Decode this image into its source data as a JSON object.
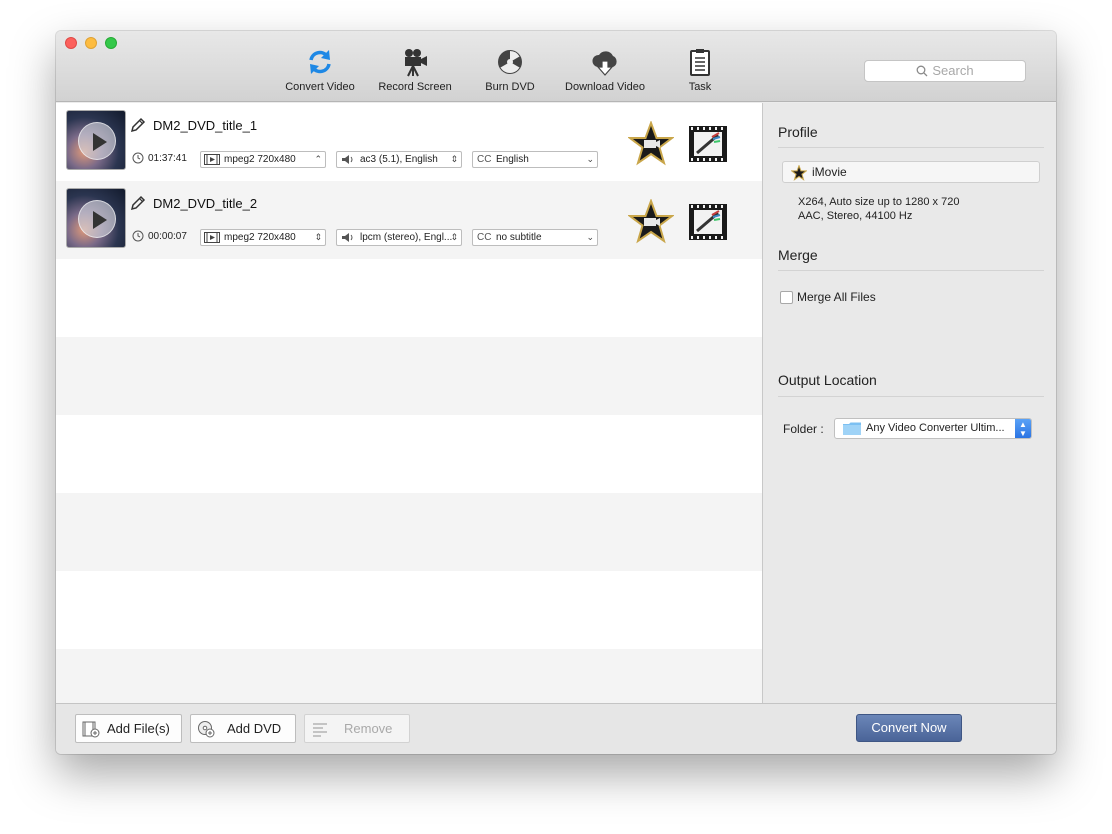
{
  "toolbar": {
    "items": [
      {
        "label": "Convert Video",
        "icon": "convert-video-icon"
      },
      {
        "label": "Record Screen",
        "icon": "record-screen-icon"
      },
      {
        "label": "Burn DVD",
        "icon": "burn-dvd-icon"
      },
      {
        "label": "Download Video",
        "icon": "download-video-icon"
      },
      {
        "label": "Task",
        "icon": "task-icon"
      }
    ],
    "search_placeholder": "Search"
  },
  "files": [
    {
      "title": "DM2_DVD_title_1",
      "duration": "01:37:41",
      "video": "mpeg2 720x480",
      "audio": "ac3 (5.1), English",
      "subtitle_tag": "CC",
      "subtitle": "English"
    },
    {
      "title": "DM2_DVD_title_2",
      "duration": "00:00:07",
      "video": "mpeg2 720x480",
      "audio": "lpcm (stereo), Engl...",
      "subtitle_tag": "CC",
      "subtitle": "no subtitle"
    }
  ],
  "panel": {
    "profile_heading": "Profile",
    "profile_name": "iMovie",
    "profile_desc_1": "X264, Auto size up to 1280 x 720",
    "profile_desc_2": "AAC, Stereo, 44100 Hz",
    "merge_heading": "Merge",
    "merge_label": "Merge All Files",
    "merge_checked": false,
    "output_heading": "Output Location",
    "folder_label": "Folder :",
    "folder_value": "Any Video Converter Ultim..."
  },
  "bottom": {
    "add_files": "Add File(s)",
    "add_dvd": "Add DVD",
    "remove": "Remove",
    "convert": "Convert Now"
  },
  "colors": {
    "convert_button": "#4a6498",
    "accent_blue": "#2b74e4",
    "row_alt": "#f4f4f4"
  }
}
